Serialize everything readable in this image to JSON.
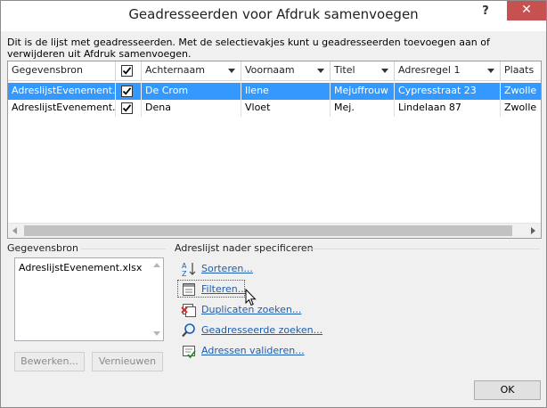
{
  "window": {
    "title": "Geadresseerden voor Afdruk samenvoegen",
    "help_label": "?",
    "close_label": "✕"
  },
  "description": "Dit is de lijst met geadresseerden. Met de selectievakjes kunt u geadresseerden toevoegen aan of verwijderen uit Afdruk samenvoegen.",
  "grid": {
    "columns": [
      "Gegevensbron",
      "",
      "Achternaam",
      "Voornaam",
      "Titel",
      "Adresregel 1",
      "Plaats"
    ],
    "header_checkbox_checked": true,
    "rows": [
      {
        "source": "AdreslijstEvenement.xlsx",
        "checked": true,
        "lastname": "De Crom",
        "firstname": "Ilene",
        "title": "Mejuffrouw",
        "address": "Cypresstraat 23",
        "city": "Zwolle",
        "selected": true
      },
      {
        "source": "AdreslijstEvenement.xlsx",
        "checked": true,
        "lastname": "Dena",
        "firstname": "Vloet",
        "title": "Mej.",
        "address": "Lindelaan 87",
        "city": "Zwolle",
        "selected": false
      }
    ]
  },
  "source_panel": {
    "label": "Gegevensbron",
    "items": [
      "AdreslijstEvenement.xlsx"
    ],
    "edit_label": "Bewerken...",
    "refresh_label": "Vernieuwen"
  },
  "refine_panel": {
    "label": "Adreslijst nader specificeren",
    "links": [
      {
        "label": "Sorteren...",
        "icon": "sort-az-icon"
      },
      {
        "label": "Filteren...",
        "icon": "filter-icon"
      },
      {
        "label": "Duplicaten zoeken...",
        "icon": "duplicates-icon"
      },
      {
        "label": "Geadresseerde zoeken...",
        "icon": "find-recipient-icon"
      },
      {
        "label": "Adressen valideren...",
        "icon": "validate-addresses-icon"
      }
    ]
  },
  "ok_label": "OK",
  "colors": {
    "selection": "#3399ff",
    "link": "#1e5dad",
    "close_button": "#c75050"
  }
}
